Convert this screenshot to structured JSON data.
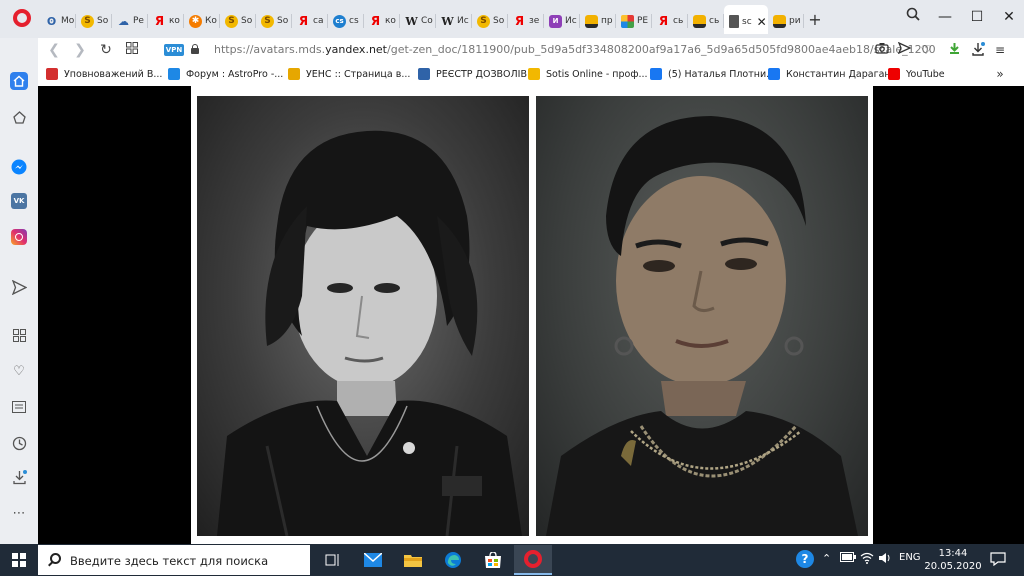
{
  "browser": {
    "tabs": [
      {
        "icon": "owl-icon",
        "label": "Мо"
      },
      {
        "icon": "sotis-icon",
        "label": "So"
      },
      {
        "icon": "cloud-icon",
        "label": "Ре"
      },
      {
        "icon": "yandex-icon",
        "label": "ко"
      },
      {
        "icon": "gear-icon",
        "label": "Ко"
      },
      {
        "icon": "sotis-icon",
        "label": "So"
      },
      {
        "icon": "sotis-icon",
        "label": "So"
      },
      {
        "icon": "yandex-icon",
        "label": "са"
      },
      {
        "icon": "cs-icon",
        "label": "cs"
      },
      {
        "icon": "yandex-icon",
        "label": "ко"
      },
      {
        "icon": "wiki-icon",
        "label": "Co"
      },
      {
        "icon": "wiki-icon",
        "label": "Ис"
      },
      {
        "icon": "sotis-icon",
        "label": "So"
      },
      {
        "icon": "yandex-icon",
        "label": "зе"
      },
      {
        "icon": "vk-icon",
        "label": "Ис"
      },
      {
        "icon": "image-icon",
        "label": "пр"
      },
      {
        "icon": "grid-icon",
        "label": "РЕ"
      },
      {
        "icon": "yandex-icon",
        "label": "сь"
      },
      {
        "icon": "image-icon",
        "label": "сь"
      }
    ],
    "active_tab": {
      "icon": "document-icon",
      "label": "sc"
    },
    "tabs_after": [
      {
        "icon": "image-icon",
        "label": "ри"
      }
    ],
    "address": {
      "vpn_badge": "VPN",
      "url_prefix": "https://avatars.mds.",
      "url_domain": "yandex.net",
      "url_path": "/get-zen_doc/1811900/pub_5d9a5df334808200af9a17a6_5d9a65d505fd9800ae4aeb18/scale_1200"
    },
    "bookmarks": [
      {
        "icon": "bookmark-ball-icon",
        "label": "Уповноважений В...",
        "color": "#d32f2f"
      },
      {
        "icon": "bookmark-windows-icon",
        "label": "Форум : AstroPro -...",
        "color": "#1e88e5"
      },
      {
        "icon": "bookmark-trident-icon",
        "label": "УЕНС :: Страница в...",
        "color": "#e6a700"
      },
      {
        "icon": "bookmark-trident-icon",
        "label": "РЕЄСТР ДОЗВОЛІВ...",
        "color": "#2f63a8"
      },
      {
        "icon": "bookmark-sotis-icon",
        "label": "Sotis Online - проф...",
        "color": "#f2b800"
      },
      {
        "icon": "bookmark-facebook-icon",
        "label": "(5) Наталья Плотни...",
        "color": "#1877f2"
      },
      {
        "icon": "bookmark-facebook-icon",
        "label": "Константин Дараган",
        "color": "#1877f2"
      },
      {
        "icon": "bookmark-youtube-icon",
        "label": "YouTube",
        "color": "#e00"
      }
    ]
  },
  "taskbar": {
    "search_placeholder": "Введите здесь текст для поиска",
    "language": "ENG",
    "time": "13:44",
    "date": "20.05.2020"
  }
}
